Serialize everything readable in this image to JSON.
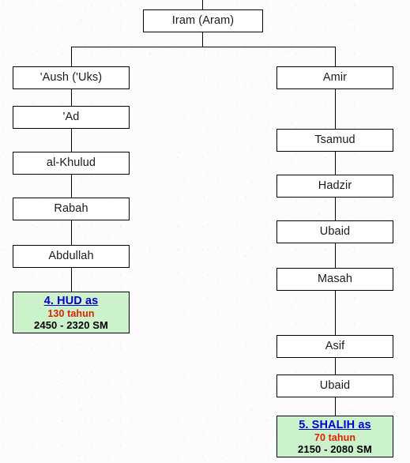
{
  "diagram": {
    "title_node": {
      "label": "Iram (Aram)"
    },
    "left_branch": [
      {
        "label": "'Aush ('Uks)"
      },
      {
        "label": "'Ad"
      },
      {
        "label": "al-Khulud"
      },
      {
        "label": "Rabah"
      },
      {
        "label": "Abdullah"
      }
    ],
    "right_branch": [
      {
        "label": "Amir"
      },
      {
        "label": "Tsamud"
      },
      {
        "label": "Hadzir"
      },
      {
        "label": "Ubaid"
      },
      {
        "label": "Masah"
      },
      {
        "label": "Asif"
      },
      {
        "label": "Ubaid"
      }
    ],
    "highlights": [
      {
        "title": "4. HUD as",
        "age": "130 tahun",
        "range": "2450 - 2320 SM"
      },
      {
        "title": "5. SHALIH as",
        "age": "70 tahun",
        "range": "2150 - 2080 SM"
      }
    ],
    "colors": {
      "highlight_fill": "#ccf2cc",
      "highlight_title": "#0000cc",
      "highlight_age": "#dd2200",
      "highlight_range": "#000000",
      "node_fill": "#ffffff",
      "node_border": "#000000",
      "node_text": "#1a1a1a",
      "background": "#fcfcfe"
    }
  }
}
